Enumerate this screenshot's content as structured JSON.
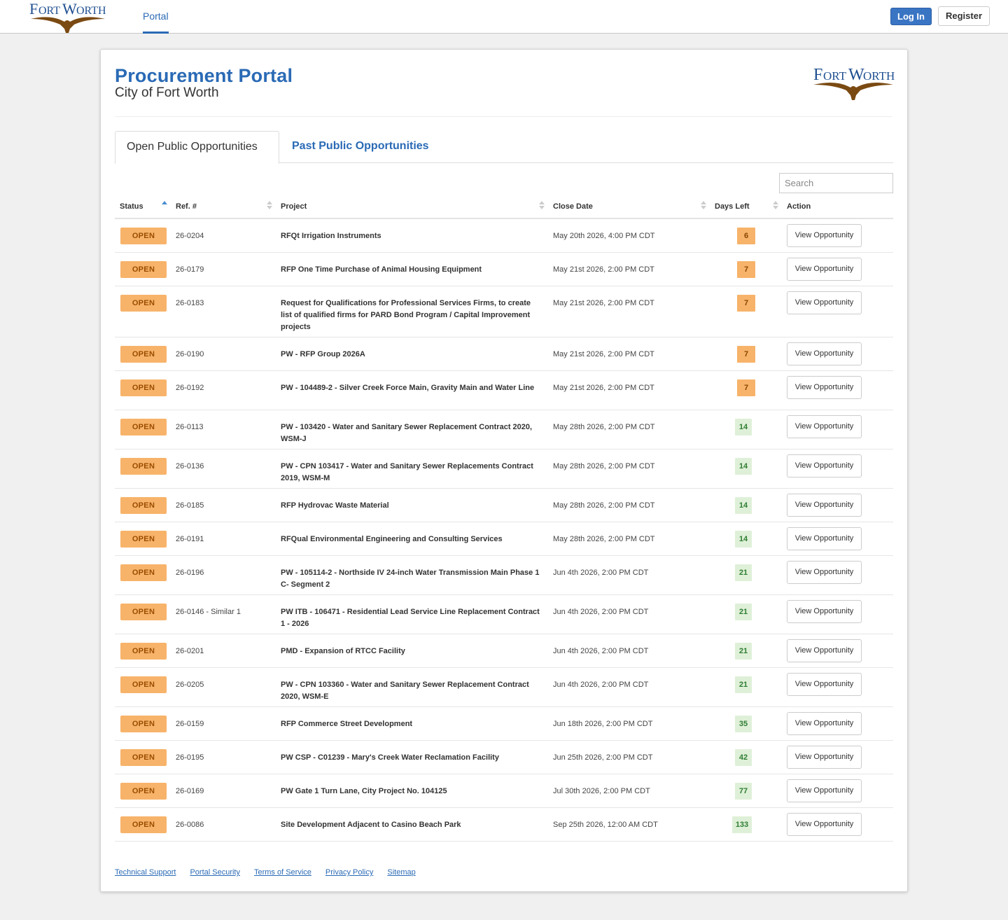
{
  "topnav": {
    "portal_tab": "Portal",
    "login": "Log In",
    "register": "Register"
  },
  "header": {
    "title": "Procurement Portal",
    "subtitle": "City of Fort Worth"
  },
  "tabs": {
    "open": "Open Public Opportunities",
    "past": "Past Public Opportunities"
  },
  "search": {
    "placeholder": "Search"
  },
  "columns": {
    "status": "Status",
    "ref": "Ref. #",
    "project": "Project",
    "close_date": "Close Date",
    "days_left": "Days Left",
    "action": "Action"
  },
  "sort_state": {
    "status": "ascending"
  },
  "colors": {
    "accent": "#2a6ab5",
    "open_badge": "#f7b36a",
    "days_urgent": "#f7b36a",
    "days_ok": "#dff0d8"
  },
  "rows": [
    {
      "status": "OPEN",
      "ref": "26-0204",
      "project": "RFQt Irrigation Instruments",
      "close_date": "May 20th 2026, 4:00 PM CDT",
      "days_left": "6",
      "urgency": "orange",
      "action": "View Opportunity"
    },
    {
      "status": "OPEN",
      "ref": "26-0179",
      "project": "RFP One Time Purchase of Animal Housing Equipment",
      "close_date": "May 21st 2026, 2:00 PM CDT",
      "days_left": "7",
      "urgency": "orange",
      "action": "View Opportunity"
    },
    {
      "status": "OPEN",
      "ref": "26-0183",
      "project": "Request for Qualifications for Professional Services Firms, to create list of qualified firms for PARD Bond Program / Capital Improvement projects",
      "close_date": "May 21st 2026, 2:00 PM CDT",
      "days_left": "7",
      "urgency": "orange",
      "action": "View Opportunity"
    },
    {
      "status": "OPEN",
      "ref": "26-0190",
      "project": "PW - RFP Group 2026A",
      "close_date": "May 21st 2026, 2:00 PM CDT",
      "days_left": "7",
      "urgency": "orange",
      "action": "View Opportunity"
    },
    {
      "status": "OPEN",
      "ref": "26-0192",
      "project": "PW - 104489-2 - Silver Creek Force Main, Gravity Main and Water Line",
      "close_date": "May 21st 2026, 2:00 PM CDT",
      "days_left": "7",
      "urgency": "orange",
      "action": "View Opportunity"
    },
    {
      "status": "OPEN",
      "ref": "26-0113",
      "project": "PW - 103420 - Water and Sanitary Sewer Replacement Contract 2020, WSM-J",
      "close_date": "May 28th 2026, 2:00 PM CDT",
      "days_left": "14",
      "urgency": "green",
      "action": "View Opportunity"
    },
    {
      "status": "OPEN",
      "ref": "26-0136",
      "project": "PW - CPN 103417 - Water and Sanitary Sewer Replacements Contract 2019, WSM-M",
      "close_date": "May 28th 2026, 2:00 PM CDT",
      "days_left": "14",
      "urgency": "green",
      "action": "View Opportunity"
    },
    {
      "status": "OPEN",
      "ref": "26-0185",
      "project": "RFP Hydrovac Waste Material",
      "close_date": "May 28th 2026, 2:00 PM CDT",
      "days_left": "14",
      "urgency": "green",
      "action": "View Opportunity"
    },
    {
      "status": "OPEN",
      "ref": "26-0191",
      "project": "RFQual Environmental Engineering and Consulting Services",
      "close_date": "May 28th 2026, 2:00 PM CDT",
      "days_left": "14",
      "urgency": "green",
      "action": "View Opportunity"
    },
    {
      "status": "OPEN",
      "ref": "26-0196",
      "project": "PW - 105114-2 - Northside IV 24-inch Water Transmission Main Phase 1 C- Segment 2",
      "close_date": "Jun 4th 2026, 2:00 PM CDT",
      "days_left": "21",
      "urgency": "green",
      "action": "View Opportunity"
    },
    {
      "status": "OPEN",
      "ref": "26-0146 - Similar 1",
      "project": "PW ITB - 106471 - Residential Lead Service Line Replacement Contract 1 - 2026",
      "close_date": "Jun 4th 2026, 2:00 PM CDT",
      "days_left": "21",
      "urgency": "green",
      "action": "View Opportunity"
    },
    {
      "status": "OPEN",
      "ref": "26-0201",
      "project": "PMD - Expansion of RTCC Facility",
      "close_date": "Jun 4th 2026, 2:00 PM CDT",
      "days_left": "21",
      "urgency": "green",
      "action": "View Opportunity"
    },
    {
      "status": "OPEN",
      "ref": "26-0205",
      "project": "PW - CPN 103360 - Water and Sanitary Sewer Replacement Contract 2020, WSM-E",
      "close_date": "Jun 4th 2026, 2:00 PM CDT",
      "days_left": "21",
      "urgency": "green",
      "action": "View Opportunity"
    },
    {
      "status": "OPEN",
      "ref": "26-0159",
      "project": "RFP Commerce Street Development",
      "close_date": "Jun 18th 2026, 2:00 PM CDT",
      "days_left": "35",
      "urgency": "green",
      "action": "View Opportunity"
    },
    {
      "status": "OPEN",
      "ref": "26-0195",
      "project": "PW CSP - C01239 - Mary's Creek Water Reclamation Facility",
      "close_date": "Jun 25th 2026, 2:00 PM CDT",
      "days_left": "42",
      "urgency": "green",
      "action": "View Opportunity"
    },
    {
      "status": "OPEN",
      "ref": "26-0169",
      "project": "PW Gate 1 Turn Lane, City Project No. 104125",
      "close_date": "Jul 30th 2026, 2:00 PM CDT",
      "days_left": "77",
      "urgency": "green",
      "action": "View Opportunity"
    },
    {
      "status": "OPEN",
      "ref": "26-0086",
      "project": "Site Development Adjacent to Casino Beach Park",
      "close_date": "Sep 25th 2026, 12:00 AM CDT",
      "days_left": "133",
      "urgency": "green",
      "action": "View Opportunity"
    }
  ],
  "footer": {
    "links": [
      "Technical Support",
      "Portal Security",
      "Terms of Service",
      "Privacy Policy",
      "Sitemap"
    ]
  }
}
